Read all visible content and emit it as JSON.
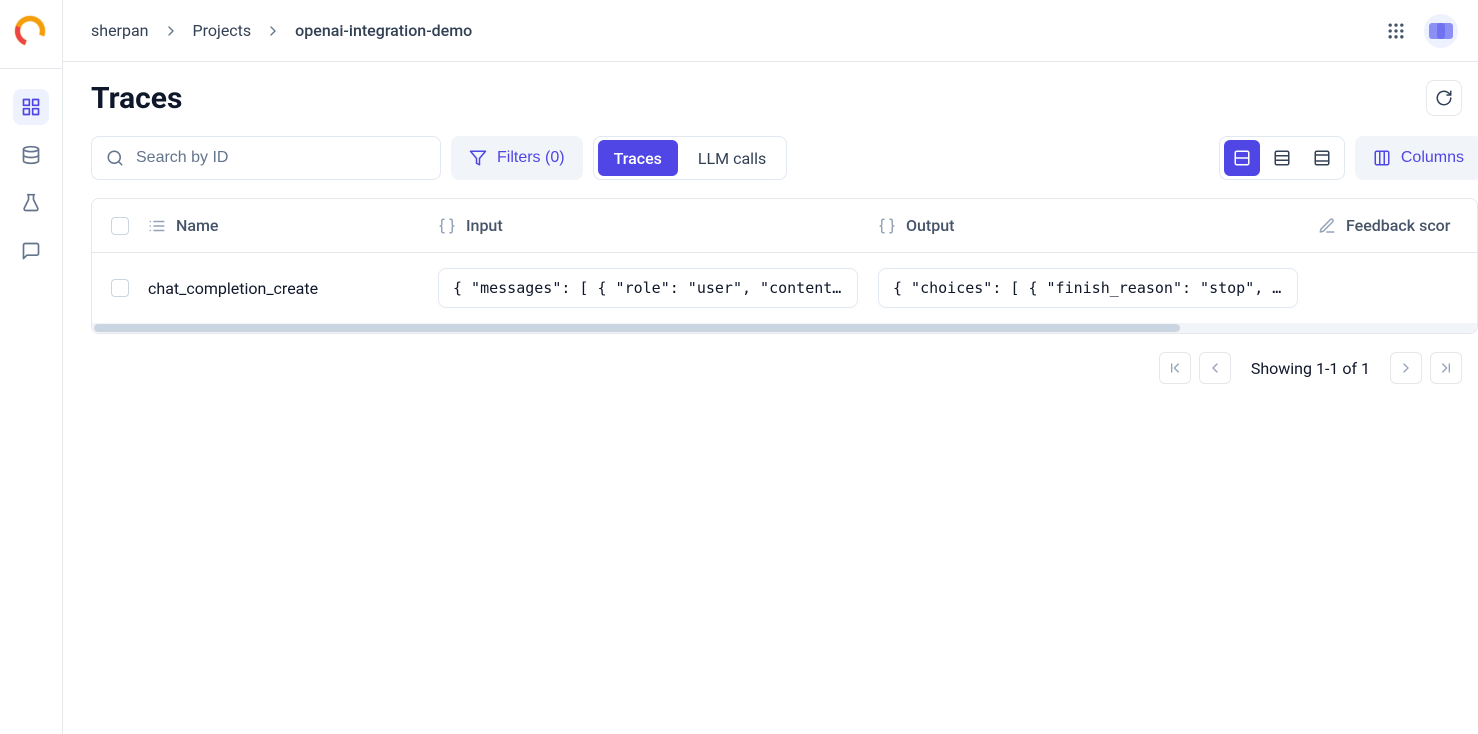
{
  "breadcrumb": {
    "org": "sherpan",
    "section": "Projects",
    "project": "openai-integration-demo"
  },
  "page": {
    "title": "Traces"
  },
  "search": {
    "placeholder": "Search by ID"
  },
  "filters": {
    "label": "Filters (0)"
  },
  "segments": {
    "traces": "Traces",
    "llm_calls": "LLM calls"
  },
  "columns": {
    "label": "Columns"
  },
  "table": {
    "headers": {
      "name": "Name",
      "input": "Input",
      "output": "Output",
      "feedback": "Feedback scor"
    },
    "rows": [
      {
        "name": "chat_completion_create",
        "input": "{ \"messages\": [ { \"role\": \"user\", \"content\": \"\\nW…",
        "output": "{ \"choices\": [ { \"finish_reason\": \"stop\", \"index\"…"
      }
    ]
  },
  "pagination": {
    "status": "Showing 1-1 of 1"
  }
}
